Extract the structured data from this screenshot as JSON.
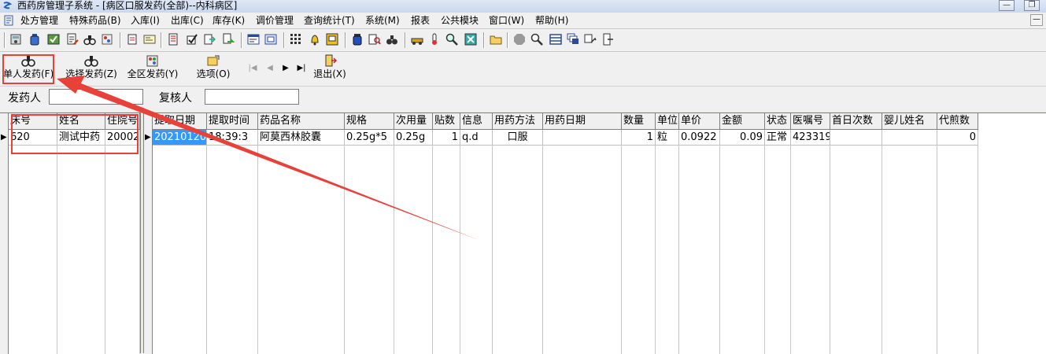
{
  "window": {
    "title": "西药房管理子系统 - [病区口服发药(全部)--内科病区]"
  },
  "menubar": {
    "items": [
      "处方管理",
      "特殊药品(B)",
      "入库(I)",
      "出库(C)",
      "库存(K)",
      "调价管理",
      "查询统计(T)",
      "系统(M)",
      "报表",
      "公共模块",
      "窗口(W)",
      "帮助(H)"
    ]
  },
  "actions": {
    "single_dispense": "单人发药(F)",
    "select_dispense": "选择发药(Z)",
    "ward_dispense": "全区发药(Y)",
    "options": "选项(O)",
    "exit": "退出(X)"
  },
  "nav": {
    "first": "|◀",
    "prev": "◀",
    "next": "▶",
    "last": "▶|"
  },
  "filters": {
    "dispenser_label": "发药人",
    "dispenser_value": "",
    "reviewer_label": "复核人",
    "reviewer_value": ""
  },
  "patient_grid": {
    "columns": [
      "床号",
      "姓名",
      "住院号"
    ],
    "rows": [
      [
        "620",
        "测试中药",
        "20002"
      ]
    ]
  },
  "order_grid": {
    "columns": [
      "提取日期",
      "提取时间",
      "药品名称",
      "规格",
      "次用量",
      "贴数",
      "信息",
      "用药方法",
      "用药日期",
      "数量",
      "单位",
      "单价",
      "金额",
      "状态",
      "医嘱号",
      "首日次数",
      "婴儿姓名",
      "代煎数"
    ],
    "rows": [
      [
        "20210120",
        "18:39:3",
        "阿莫西林胶囊",
        "0.25g*5",
        "0.25g",
        "1",
        "q.d",
        "口服",
        "",
        "1",
        "粒",
        "0.0922",
        "0.09",
        "正常",
        "423319",
        "",
        "",
        "0"
      ]
    ]
  },
  "colors": {
    "highlight": "#3399ff",
    "annotation": "#e8413a"
  }
}
